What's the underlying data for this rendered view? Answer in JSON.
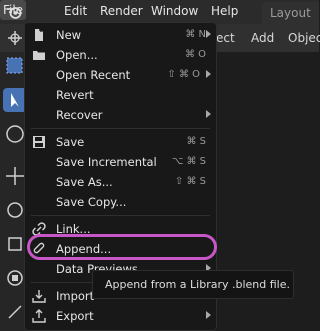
{
  "menubar": {
    "items": [
      "File",
      "Edit",
      "Render",
      "Window",
      "Help"
    ],
    "workspace_tab": "Layout"
  },
  "viewport_header": {
    "items": [
      "ect",
      "Add",
      "Object"
    ]
  },
  "file_menu": {
    "items": [
      {
        "label": "New",
        "shortcut": "⌘ N",
        "submenu": true,
        "icon": "new-file-icon"
      },
      {
        "label": "Open...",
        "shortcut": "⌘ O",
        "submenu": false,
        "icon": "folder-icon"
      },
      {
        "label": "Open Recent",
        "shortcut": "⇧ ⌘ O",
        "submenu": true,
        "icon": ""
      },
      {
        "label": "Revert",
        "shortcut": "",
        "submenu": false,
        "icon": ""
      },
      {
        "label": "Recover",
        "shortcut": "",
        "submenu": true,
        "icon": ""
      },
      {
        "label": "Save",
        "shortcut": "⌘ S",
        "submenu": false,
        "icon": "save-icon"
      },
      {
        "label": "Save Incremental",
        "shortcut": "⌥ ⌘ S",
        "submenu": false,
        "icon": ""
      },
      {
        "label": "Save As...",
        "shortcut": "⇧ ⌘ S",
        "submenu": false,
        "icon": ""
      },
      {
        "label": "Save Copy...",
        "shortcut": "",
        "submenu": false,
        "icon": ""
      },
      {
        "label": "Link...",
        "shortcut": "",
        "submenu": false,
        "icon": "link-icon"
      },
      {
        "label": "Append...",
        "shortcut": "",
        "submenu": false,
        "icon": "paperclip-icon"
      },
      {
        "label": "Data Previews",
        "shortcut": "",
        "submenu": true,
        "icon": ""
      },
      {
        "label": "Import",
        "shortcut": "",
        "submenu": true,
        "icon": "import-icon"
      },
      {
        "label": "Export",
        "shortcut": "",
        "submenu": true,
        "icon": "export-icon"
      }
    ]
  },
  "tooltip": {
    "text": "Append from a Library .blend file."
  },
  "colors": {
    "highlight": "#c757c6",
    "active_tool": "#4772b3",
    "menu_bg": "#181818"
  }
}
